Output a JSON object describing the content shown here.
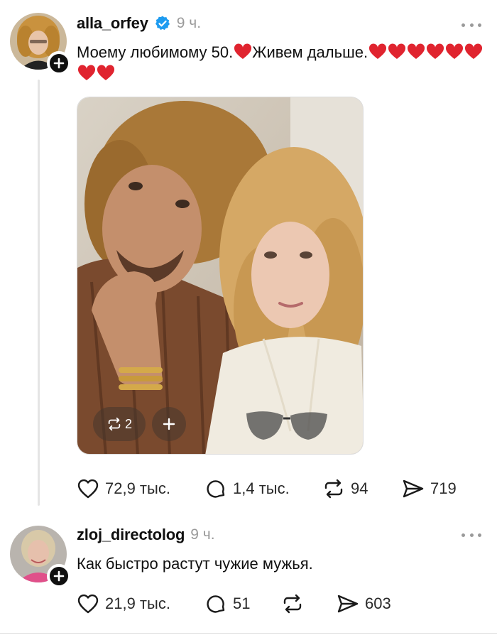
{
  "post1": {
    "username": "alla_orfey",
    "verified": true,
    "time": "9 ч.",
    "caption_part1": "Моему любимому 50.",
    "caption_part2": "Живем дальше.",
    "photo_repost_count": "2",
    "likes": "72,9 тыс.",
    "replies": "1,4 тыс.",
    "reposts": "94",
    "shares": "719"
  },
  "post2": {
    "username": "zloj_directolog",
    "time": "9 ч.",
    "caption": "Как быстро растут чужие мужья.",
    "likes": "21,9 тыс.",
    "replies": "51",
    "reposts": "",
    "shares": "603"
  },
  "colors": {
    "text": "#101010",
    "muted": "#9a9a9a",
    "verified_blue": "#1d9bf0",
    "heart_red": "#e0242f",
    "thread_line": "#e5e5e5"
  },
  "icons": [
    "plus-icon",
    "verified-icon",
    "more-icon",
    "heart-icon",
    "reply-icon",
    "repost-icon",
    "share-icon",
    "red-heart-emoji"
  ]
}
